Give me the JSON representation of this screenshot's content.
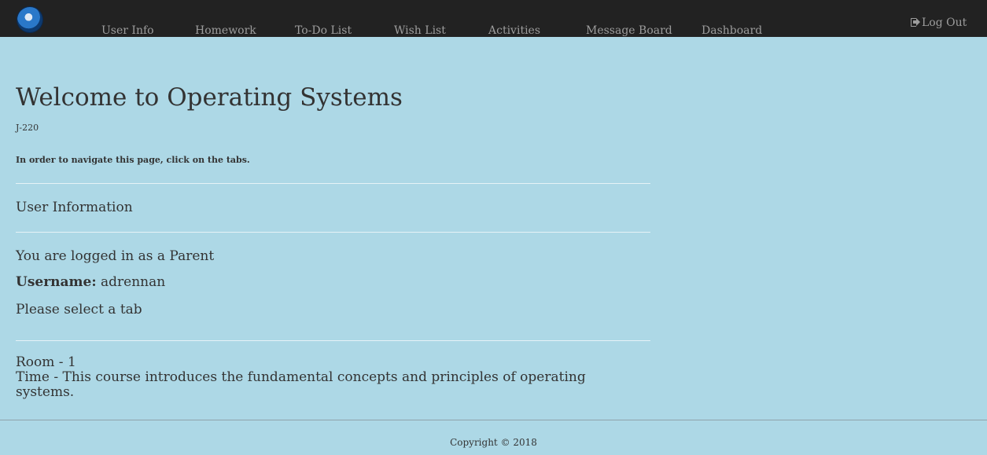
{
  "navbar": {
    "logo_icon": "dragon-logo",
    "items": [
      {
        "label": "User Info"
      },
      {
        "label": "Homework"
      },
      {
        "label": "To-Do List"
      },
      {
        "label": "Wish List"
      },
      {
        "label": "Activities"
      },
      {
        "label": "Message Board"
      },
      {
        "label": "Dashboard"
      }
    ],
    "logout": {
      "label": "Log Out",
      "icon": "logout-icon"
    }
  },
  "main": {
    "title": "Welcome to Operating Systems",
    "course_code": "J-220",
    "nav_hint": "In order to navigate this page, click on the tabs.",
    "section_title": "User Information",
    "logged_in_text": "You are logged in as a Parent",
    "username_label": "Username:",
    "username_value": "adrennan",
    "select_tab_text": "Please select a tab",
    "room_text": "Room - 1",
    "time_text": "Time - This course introduces the fundamental concepts and principles of operating systems."
  },
  "footer": {
    "copyright": "Copyright © 2018"
  },
  "colors": {
    "background": "#add8e6",
    "navbar": "#222222",
    "nav_text": "#9d9d9d",
    "text": "#333333"
  }
}
